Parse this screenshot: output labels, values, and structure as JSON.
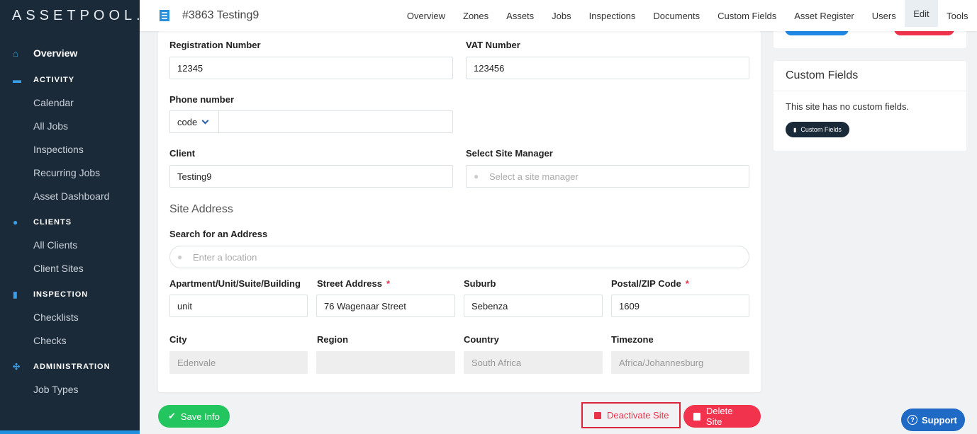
{
  "app": {
    "logo": "ASSETPOOL."
  },
  "sidebar": {
    "overview": "Overview",
    "sections": [
      {
        "label": "ACTIVITY",
        "items": [
          "Calendar",
          "All Jobs",
          "Inspections",
          "Recurring Jobs",
          "Asset Dashboard"
        ]
      },
      {
        "label": "CLIENTS",
        "items": [
          "All Clients",
          "Client Sites"
        ]
      },
      {
        "label": "INSPECTION",
        "items": [
          "Checklists",
          "Checks"
        ]
      },
      {
        "label": "ADMINISTRATION",
        "items": [
          "Job Types"
        ]
      }
    ]
  },
  "header": {
    "site_title": "#3863 Testing9",
    "tabs": [
      "Overview",
      "Zones",
      "Assets",
      "Jobs",
      "Inspections",
      "Documents",
      "Custom Fields",
      "Asset Register",
      "Users",
      "Edit",
      "Tools"
    ],
    "active_tab": "Edit"
  },
  "form": {
    "registration_number": {
      "label": "Registration Number",
      "value": "12345"
    },
    "vat_number": {
      "label": "VAT Number",
      "value": "123456"
    },
    "phone": {
      "label": "Phone number",
      "code": "code",
      "value": ""
    },
    "client": {
      "label": "Client",
      "value": "Testing9"
    },
    "site_manager": {
      "label": "Select Site Manager",
      "placeholder": "Select a site manager"
    },
    "site_address_title": "Site Address",
    "search_address": {
      "label": "Search for an Address",
      "placeholder": "Enter a location"
    },
    "apartment": {
      "label": "Apartment/Unit/Suite/Building",
      "value": "unit"
    },
    "street": {
      "label": "Street Address",
      "required": "*",
      "value": "76 Wagenaar Street"
    },
    "suburb": {
      "label": "Suburb",
      "value": "Sebenza"
    },
    "postal": {
      "label": "Postal/ZIP Code",
      "required": "*",
      "value": "1609"
    },
    "city": {
      "label": "City",
      "value": "Edenvale"
    },
    "region": {
      "label": "Region",
      "value": ""
    },
    "country": {
      "label": "Country",
      "value": "South Africa"
    },
    "timezone": {
      "label": "Timezone",
      "value": "Africa/Johannesburg"
    }
  },
  "actions": {
    "save": "Save Info",
    "deactivate": "Deactivate Site",
    "delete": "Delete Site"
  },
  "custom_fields_panel": {
    "title": "Custom Fields",
    "message": "This site has no custom fields.",
    "button": "Custom Fields"
  },
  "support": "Support",
  "colors": {
    "sidebar": "#1b2a38",
    "accent": "#1f8fe0",
    "save": "#23c55e",
    "danger": "#f1334e"
  }
}
